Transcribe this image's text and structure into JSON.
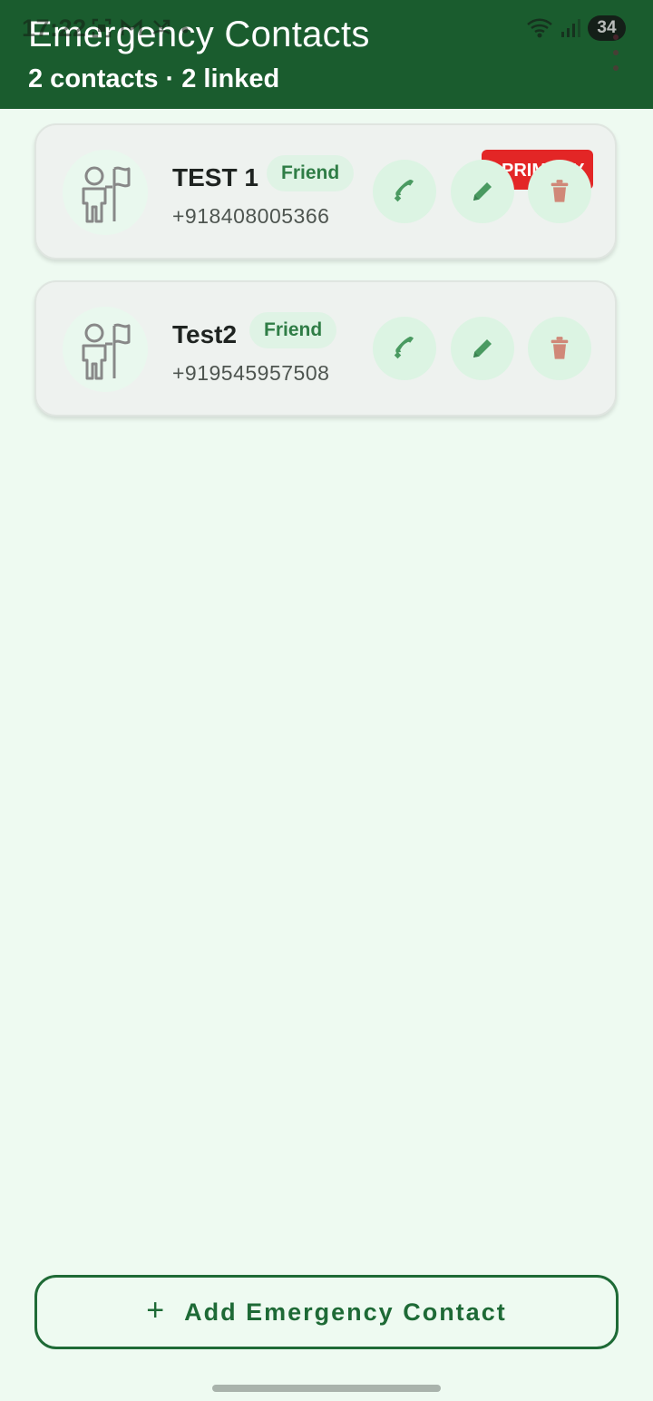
{
  "status_bar": {
    "time": "17:22",
    "battery": "34",
    "left_icons": [
      "screenshot-icon",
      "gmail-icon",
      "missed-call-icon",
      "dot-icon"
    ],
    "right_icons": [
      "wifi-icon",
      "signal-icon",
      "battery-icon"
    ]
  },
  "header": {
    "title": "Emergency Contacts",
    "subtitle": "2 contacts · 2 linked",
    "background": "#1a5c2e"
  },
  "contacts": [
    {
      "name": "TEST 1",
      "relation": "Friend",
      "phone": "+918408005366",
      "primary_label": "PRIMARY",
      "primary": true
    },
    {
      "name": "Test2",
      "relation": "Friend",
      "phone": "+919545957508",
      "primary": false
    }
  ],
  "actions": {
    "call_icon": "phone-icon",
    "edit_icon": "pencil-icon",
    "delete_icon": "trash-icon"
  },
  "add_button": {
    "icon": "+",
    "label": "Add Emergency Contact"
  },
  "colors": {
    "accent": "#1e6a36",
    "primary_badge": "#e32626",
    "page_background": "#eefaf1"
  }
}
